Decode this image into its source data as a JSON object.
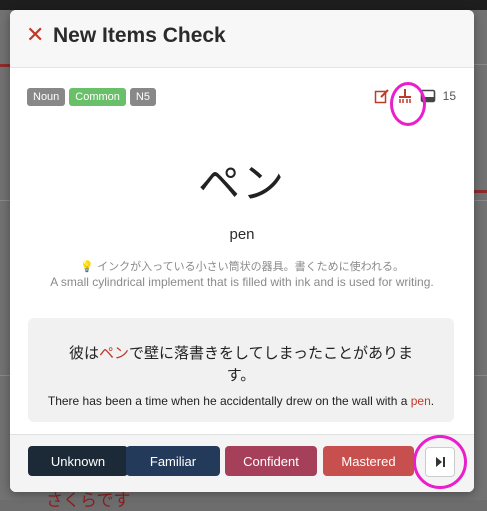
{
  "header": {
    "title": "New Items Check",
    "close_glyph": "✕"
  },
  "tags": [
    {
      "label": "Noun",
      "color": "#888888"
    },
    {
      "label": "Common",
      "color": "#6abf69"
    },
    {
      "label": "N5",
      "color": "#888888"
    }
  ],
  "top_icons": {
    "edit": "edit-icon",
    "broom": "broom-icon",
    "inbox": "inbox-icon",
    "count": "15"
  },
  "word": {
    "kana": "ペン",
    "meaning": "pen",
    "definition_jp": "インクが入っている小さい筒状の器具。書くために使われる。",
    "definition_en": "A small cylindrical implement that is filled with ink and is used for writing."
  },
  "example": {
    "jp_parts": [
      "彼は",
      "ペン",
      "で壁に落書きをしてしまったことがありま",
      "す。"
    ],
    "en_before": "There has been a time when he accidentally drew on the wall with a ",
    "en_highlight": "pen",
    "en_after": "."
  },
  "buttons": {
    "unknown": "Unknown",
    "familiar": "Familiar",
    "confident": "Confident",
    "mastered": "Mastered"
  },
  "colors": {
    "unknown": "#1c2a38",
    "familiar": "#243a5a",
    "confident": "#a6405a",
    "mastered": "#c7504f",
    "accent": "#c0392b",
    "highlight": "#e91ecc"
  },
  "background_page": {
    "text": "さくらです"
  }
}
